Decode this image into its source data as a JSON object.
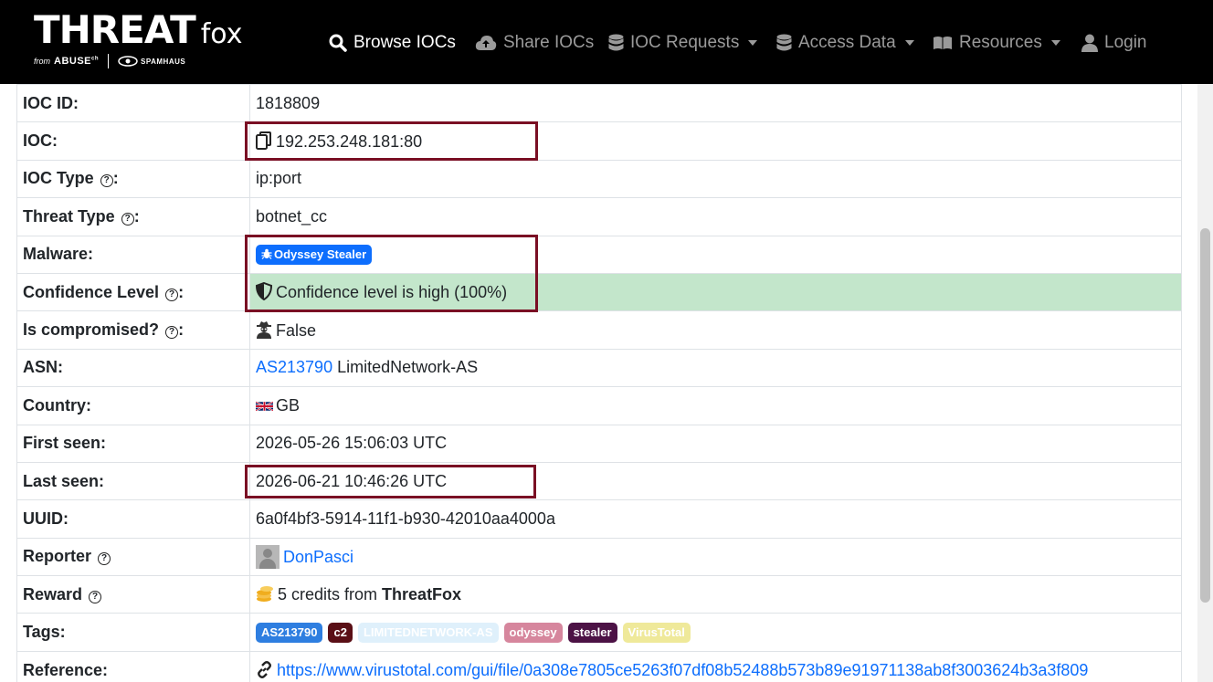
{
  "brand": {
    "main": "THREAT",
    "fox": "fox",
    "from": "from",
    "abuse": "ABUSE",
    "abuse_sup": "ch",
    "spamhaus": "SPAMHAUS"
  },
  "nav": {
    "browse": "Browse IOCs",
    "share": "Share IOCs",
    "requests": "IOC Requests",
    "access": "Access Data",
    "resources": "Resources",
    "login": "Login"
  },
  "colors": {
    "highlight_row": "#c3e6cb",
    "annotation_box": "#7a0f24",
    "link": "#0d6efd"
  },
  "rows": {
    "ioc_id": {
      "label": "IOC ID:",
      "value": "1818809"
    },
    "ioc": {
      "label": "IOC:",
      "value": "192.253.248.181:80",
      "icon": "copy-icon"
    },
    "ioc_type": {
      "label": "IOC Type",
      "suffix": ":",
      "value": "ip:port"
    },
    "threat_type": {
      "label": "Threat Type",
      "suffix": ":",
      "value": "botnet_cc"
    },
    "malware": {
      "label": "Malware:",
      "value": "Odyssey Stealer",
      "icon": "bug-icon"
    },
    "confidence": {
      "label": "Confidence Level",
      "suffix": ":",
      "value": "Confidence level is high (100%)",
      "icon": "shield-icon"
    },
    "compromised": {
      "label": "Is compromised?",
      "suffix": ":",
      "value": "False",
      "icon": "user-secret-icon"
    },
    "asn": {
      "label": "ASN:",
      "link": "AS213790",
      "value": "LimitedNetwork-AS"
    },
    "country": {
      "label": "Country:",
      "value": "GB",
      "icon": "gb-flag-icon"
    },
    "first_seen": {
      "label": "First seen:",
      "value": "2026-05-26 15:06:03 UTC"
    },
    "last_seen": {
      "label": "Last seen:",
      "value": "2026-06-21 10:46:26 UTC"
    },
    "uuid": {
      "label": "UUID:",
      "value": "6a0f4bf3-5914-11f1-b930-42010aa4000a"
    },
    "reporter": {
      "label": "Reporter",
      "value": "DonPasci"
    },
    "reward": {
      "label": "Reward",
      "value_prefix": "5 credits from",
      "value_bold": "ThreatFox",
      "icon": "coins-icon"
    },
    "tags": {
      "label": "Tags:",
      "items": [
        {
          "text": "AS213790",
          "color": "#2e7ee0"
        },
        {
          "text": "c2",
          "color": "#5a0f16"
        },
        {
          "text": "LIMITEDNETWORK-AS",
          "color": "#dff0fb"
        },
        {
          "text": "odyssey",
          "color": "#d6869d"
        },
        {
          "text": "stealer",
          "color": "#4c1245"
        },
        {
          "text": "VirusTotal",
          "color": "#efe99a"
        }
      ]
    },
    "reference": {
      "label": "Reference:",
      "value": "https://www.virustotal.com/gui/file/0a308e7805ce5263f07df08b52488b573b89e91971138ab8f3003624b3a3f809",
      "icon": "link-icon"
    }
  }
}
